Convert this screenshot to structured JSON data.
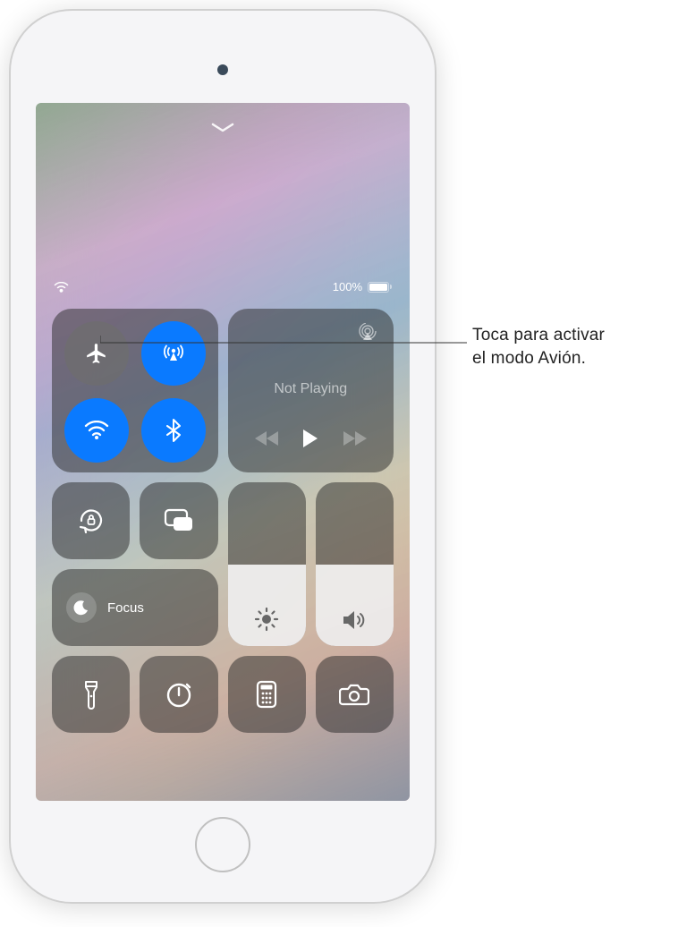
{
  "status": {
    "battery_text": "100%"
  },
  "media": {
    "now_playing": "Not Playing"
  },
  "focus": {
    "label": "Focus"
  },
  "brightness": {
    "level_percent": 50
  },
  "volume": {
    "level_percent": 50
  },
  "callout": {
    "line1": "Toca para activar",
    "line2": "el modo Avión."
  },
  "icons": {
    "airplane": "airplane-icon",
    "airdrop": "airdrop-icon",
    "wifi": "wifi-icon",
    "bluetooth": "bluetooth-icon",
    "airplay": "airplay-icon",
    "rewind": "rewind-icon",
    "play": "play-icon",
    "forward": "forward-icon",
    "rotation_lock": "rotation-lock-icon",
    "screen_mirroring": "screen-mirroring-icon",
    "dnd": "moon-icon",
    "brightness": "sun-icon",
    "volume": "speaker-icon",
    "flashlight": "flashlight-icon",
    "timer": "timer-icon",
    "calculator": "calculator-icon",
    "camera": "camera-icon",
    "dismiss": "chevron-down-icon",
    "wifi_status": "wifi-status-icon"
  }
}
